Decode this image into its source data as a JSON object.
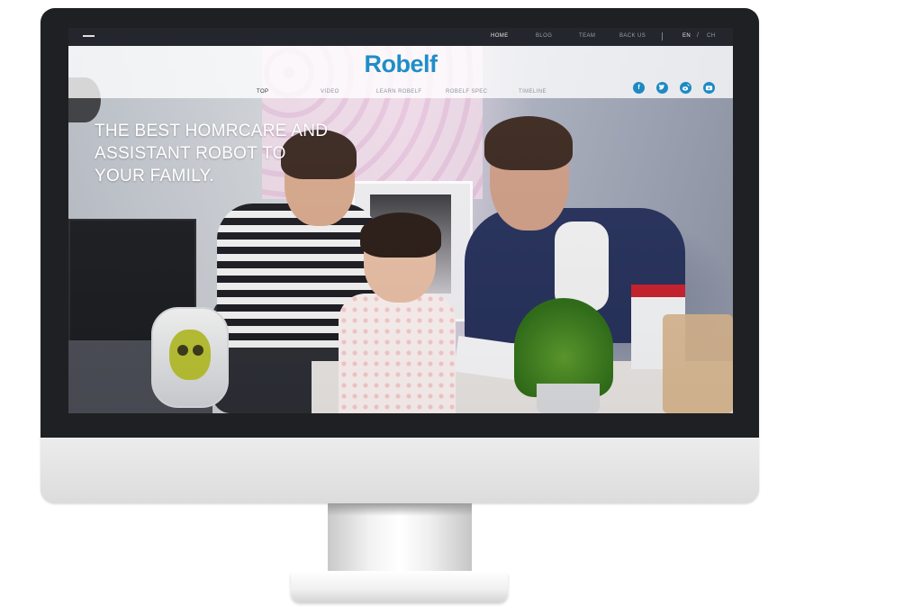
{
  "topbar": {
    "links": [
      "HOME",
      "BLOG",
      "TEAM",
      "BACK US"
    ],
    "active": "HOME",
    "languages": [
      "EN",
      "CH"
    ],
    "lang_separator": "/"
  },
  "header": {
    "logo_text": "Robelf",
    "nav": [
      "TOP",
      "VIDEO",
      "LEARN ROBELF",
      "ROBELF SPEC",
      "TIMELINE"
    ],
    "active_nav": "TOP",
    "social_icons": [
      "facebook-icon",
      "twitter-icon",
      "weibo-icon",
      "youtube-icon"
    ],
    "brand_color": "#1f8ec7"
  },
  "hero": {
    "headline_lines": [
      "THE BEST HOMRCARE AND",
      "ASSISTANT ROBOT TO",
      "YOUR FAMILY."
    ]
  }
}
